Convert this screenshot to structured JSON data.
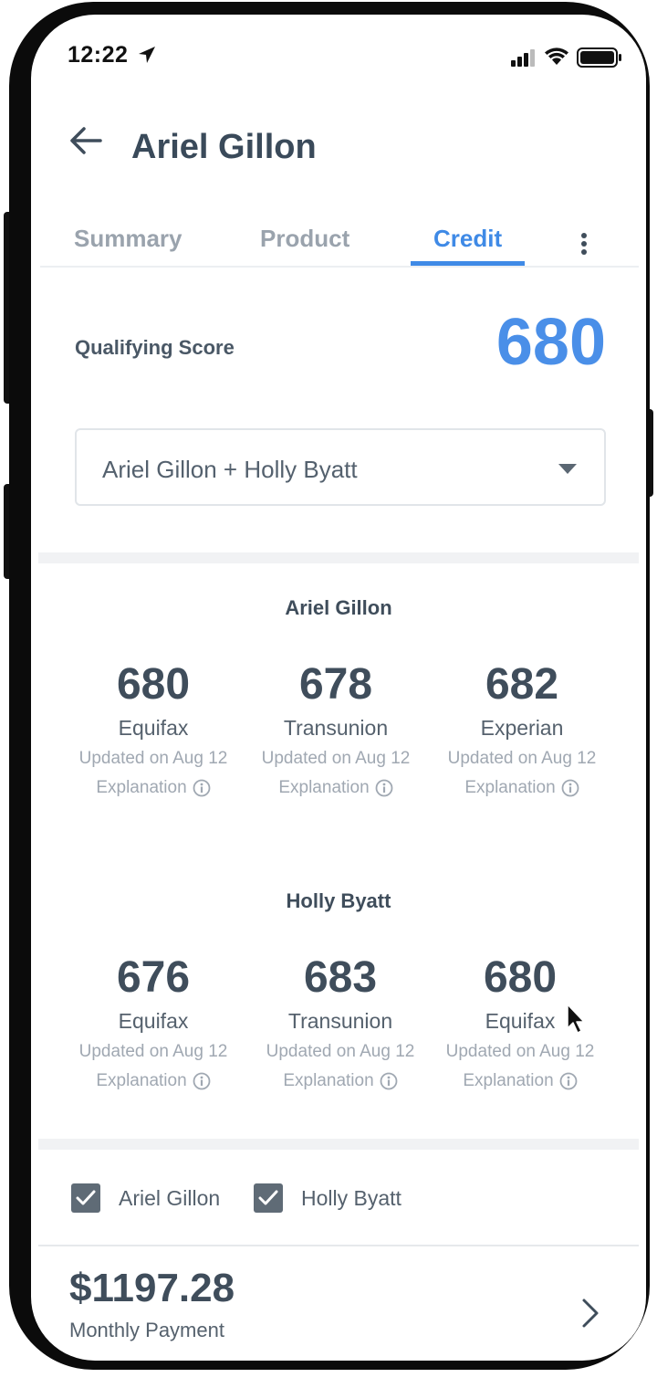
{
  "status_bar": {
    "time": "12:22"
  },
  "header": {
    "title": "Ariel Gillon"
  },
  "tabs": [
    {
      "label": "Summary",
      "active": false
    },
    {
      "label": "Product",
      "active": false
    },
    {
      "label": "Credit",
      "active": true
    }
  ],
  "qualifying": {
    "label": "Qualifying Score",
    "score": "680"
  },
  "applicant_select": {
    "value": "Ariel Gillon + Holly Byatt"
  },
  "groups": [
    {
      "name": "Ariel Gillon",
      "scores": [
        {
          "score": "680",
          "bureau": "Equifax",
          "updated": "Updated on Aug 12",
          "explanation": "Explanation"
        },
        {
          "score": "678",
          "bureau": "Transunion",
          "updated": "Updated on Aug 12",
          "explanation": "Explanation"
        },
        {
          "score": "682",
          "bureau": "Experian",
          "updated": "Updated on Aug 12",
          "explanation": "Explanation"
        }
      ]
    },
    {
      "name": "Holly Byatt",
      "scores": [
        {
          "score": "676",
          "bureau": "Equifax",
          "updated": "Updated on Aug 12",
          "explanation": "Explanation"
        },
        {
          "score": "683",
          "bureau": "Transunion",
          "updated": "Updated on Aug 12",
          "explanation": "Explanation"
        },
        {
          "score": "680",
          "bureau": "Equifax",
          "updated": "Updated on Aug 12",
          "explanation": "Explanation"
        }
      ]
    }
  ],
  "checkboxes": [
    {
      "label": "Ariel Gillon",
      "checked": true
    },
    {
      "label": "Holly Byatt",
      "checked": true
    }
  ],
  "payment": {
    "amount": "$1197.28",
    "label": "Monthly Payment"
  },
  "colors": {
    "accent": "#3f8ae6",
    "text": "#3f4d5b",
    "muted": "#a0a8b2",
    "checkbox": "#5f6b76"
  },
  "icons": [
    "location-arrow-icon",
    "signal-icon",
    "wifi-icon",
    "battery-icon",
    "back-arrow-icon",
    "more-vertical-icon",
    "caret-down-icon",
    "info-icon",
    "checkmark-icon",
    "chevron-right-icon",
    "mouse-cursor-icon"
  ]
}
